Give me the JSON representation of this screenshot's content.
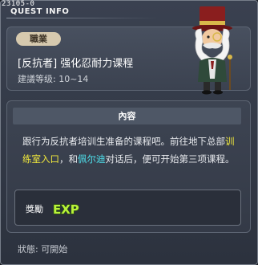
{
  "header": {
    "quest_id": "23105-0",
    "title": "QUEST INFO"
  },
  "quest": {
    "job_badge": "職業",
    "name": "[反抗者] 强化忍耐力课程",
    "level": "建議等级: 10~14"
  },
  "content": {
    "section_title": "內容",
    "desc_part1": "跟行为反抗者培训生准备的课程吧。前往地下总部",
    "desc_location": "训练室入口",
    "desc_part2": "，和",
    "desc_npc": "佩尔迪",
    "desc_part3": "对话后，便可开始第三项课程。"
  },
  "reward": {
    "label": "獎勵",
    "exp_text": "EXP"
  },
  "status": {
    "text": "狀態:  可開始"
  },
  "colors": {
    "highlight_location": "#f2ea3c",
    "highlight_npc": "#4ee0ec",
    "exp_green": "#b9f23a"
  }
}
